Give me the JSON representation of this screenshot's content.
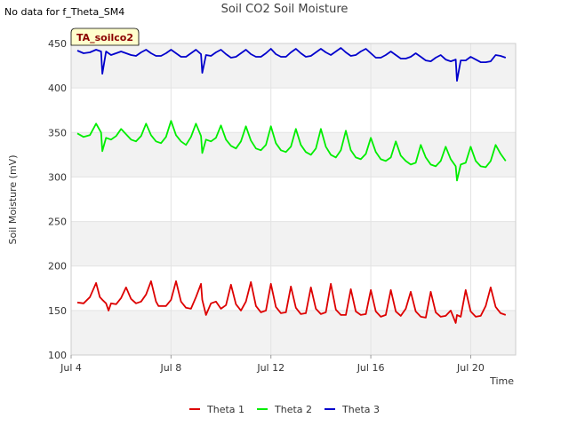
{
  "header": {
    "no_data_text": "No data for f_Theta_SM4",
    "title": "Soil CO2 Soil Moisture"
  },
  "chart_data": {
    "type": "line",
    "title": "Soil CO2 Soil Moisture",
    "xlabel": "Time",
    "ylabel": "Soil Moisture (mV)",
    "xlim": [
      4.0,
      21.8
    ],
    "ylim": [
      100,
      450
    ],
    "x_ticks": [
      4,
      8,
      12,
      16,
      20
    ],
    "x_tick_labels": [
      "Jul 4",
      "Jul 8",
      "Jul 12",
      "Jul 16",
      "Jul 20"
    ],
    "y_ticks": [
      100,
      150,
      200,
      250,
      300,
      350,
      400,
      450
    ],
    "y_tick_labels": [
      "100",
      "150",
      "200",
      "250",
      "300",
      "350",
      "400",
      "450"
    ],
    "grid": true,
    "banded_background": true,
    "legend_position": "bottom-center",
    "annotation_box": {
      "text": "TA_soilco2",
      "text_color": "#8B0000",
      "background": "#FFFFCC"
    },
    "x_units": "day of July",
    "series": [
      {
        "name": "Theta 1",
        "color": "#DD0000",
        "x": [
          4.25,
          4.5,
          4.75,
          5.0,
          5.15,
          5.25,
          5.4,
          5.5,
          5.6,
          5.8,
          6.0,
          6.2,
          6.4,
          6.6,
          6.8,
          7.0,
          7.2,
          7.4,
          7.5,
          7.8,
          8.0,
          8.2,
          8.4,
          8.6,
          8.8,
          9.0,
          9.2,
          9.25,
          9.4,
          9.6,
          9.8,
          10.0,
          10.2,
          10.4,
          10.6,
          10.8,
          11.0,
          11.2,
          11.4,
          11.6,
          11.8,
          12.0,
          12.2,
          12.4,
          12.6,
          12.8,
          13.0,
          13.2,
          13.4,
          13.6,
          13.8,
          14.0,
          14.2,
          14.4,
          14.6,
          14.8,
          15.0,
          15.2,
          15.4,
          15.6,
          15.8,
          16.0,
          16.2,
          16.4,
          16.6,
          16.8,
          17.0,
          17.2,
          17.4,
          17.6,
          17.8,
          18.0,
          18.2,
          18.4,
          18.6,
          18.8,
          19.0,
          19.2,
          19.4,
          19.45,
          19.6,
          19.8,
          20.0,
          20.2,
          20.4,
          20.6,
          20.8,
          21.0,
          21.2,
          21.4
        ],
        "y": [
          159,
          158,
          165,
          181,
          165,
          162,
          158,
          150,
          158,
          157,
          164,
          176,
          163,
          158,
          160,
          168,
          183,
          160,
          155,
          155,
          162,
          183,
          160,
          153,
          152,
          165,
          180,
          162,
          145,
          158,
          160,
          152,
          156,
          179,
          157,
          150,
          160,
          182,
          155,
          148,
          150,
          180,
          154,
          147,
          148,
          177,
          153,
          146,
          147,
          176,
          152,
          146,
          148,
          180,
          151,
          145,
          145,
          174,
          149,
          145,
          146,
          173,
          149,
          143,
          145,
          173,
          149,
          144,
          152,
          171,
          149,
          143,
          142,
          171,
          148,
          143,
          144,
          150,
          136,
          145,
          143,
          173,
          149,
          143,
          144,
          155,
          176,
          154,
          147,
          145
        ]
      },
      {
        "name": "Theta 2",
        "color": "#00EE00",
        "x": [
          4.25,
          4.5,
          4.75,
          5.0,
          5.2,
          5.25,
          5.4,
          5.6,
          5.8,
          6.0,
          6.2,
          6.4,
          6.6,
          6.8,
          7.0,
          7.2,
          7.4,
          7.6,
          7.8,
          8.0,
          8.2,
          8.4,
          8.6,
          8.8,
          9.0,
          9.2,
          9.25,
          9.4,
          9.6,
          9.8,
          10.0,
          10.2,
          10.4,
          10.6,
          10.8,
          11.0,
          11.2,
          11.4,
          11.6,
          11.8,
          12.0,
          12.2,
          12.4,
          12.6,
          12.8,
          13.0,
          13.2,
          13.4,
          13.6,
          13.8,
          14.0,
          14.2,
          14.4,
          14.6,
          14.8,
          15.0,
          15.2,
          15.4,
          15.6,
          15.8,
          16.0,
          16.2,
          16.4,
          16.6,
          16.8,
          17.0,
          17.2,
          17.4,
          17.6,
          17.8,
          18.0,
          18.2,
          18.4,
          18.6,
          18.8,
          19.0,
          19.2,
          19.4,
          19.45,
          19.6,
          19.8,
          20.0,
          20.2,
          20.4,
          20.6,
          20.8,
          21.0,
          21.2,
          21.4
        ],
        "y": [
          349,
          345,
          347,
          360,
          350,
          329,
          344,
          342,
          346,
          354,
          348,
          342,
          340,
          346,
          360,
          347,
          340,
          338,
          345,
          363,
          347,
          340,
          336,
          345,
          360,
          346,
          327,
          342,
          340,
          344,
          358,
          342,
          335,
          332,
          340,
          357,
          341,
          332,
          330,
          336,
          357,
          338,
          330,
          328,
          334,
          354,
          336,
          328,
          325,
          332,
          354,
          334,
          325,
          322,
          330,
          352,
          330,
          322,
          320,
          326,
          344,
          328,
          320,
          318,
          322,
          340,
          324,
          318,
          314,
          316,
          336,
          322,
          314,
          312,
          318,
          334,
          320,
          312,
          296,
          314,
          316,
          334,
          318,
          312,
          311,
          318,
          336,
          326,
          318
        ]
      },
      {
        "name": "Theta 3",
        "color": "#0000CC",
        "x": [
          4.25,
          4.5,
          4.75,
          5.0,
          5.2,
          5.25,
          5.4,
          5.6,
          5.8,
          6.0,
          6.2,
          6.4,
          6.6,
          6.8,
          7.0,
          7.2,
          7.4,
          7.6,
          7.8,
          8.0,
          8.2,
          8.4,
          8.6,
          8.8,
          9.0,
          9.2,
          9.25,
          9.4,
          9.6,
          9.8,
          10.0,
          10.2,
          10.4,
          10.6,
          10.8,
          11.0,
          11.2,
          11.4,
          11.6,
          11.8,
          12.0,
          12.2,
          12.4,
          12.6,
          12.8,
          13.0,
          13.2,
          13.4,
          13.6,
          13.8,
          14.0,
          14.2,
          14.4,
          14.6,
          14.8,
          15.0,
          15.2,
          15.4,
          15.6,
          15.8,
          16.0,
          16.2,
          16.4,
          16.6,
          16.8,
          17.0,
          17.2,
          17.4,
          17.6,
          17.8,
          18.0,
          18.2,
          18.4,
          18.6,
          18.8,
          19.0,
          19.2,
          19.4,
          19.45,
          19.6,
          19.8,
          20.0,
          20.2,
          20.4,
          20.6,
          20.8,
          21.0,
          21.2,
          21.4
        ],
        "y": [
          442,
          439,
          440,
          443,
          441,
          416,
          441,
          437,
          439,
          441,
          439,
          437,
          436,
          440,
          443,
          439,
          436,
          436,
          439,
          443,
          439,
          435,
          435,
          439,
          443,
          438,
          417,
          437,
          436,
          440,
          443,
          438,
          434,
          435,
          439,
          443,
          438,
          435,
          435,
          439,
          444,
          438,
          435,
          435,
          440,
          444,
          439,
          435,
          436,
          440,
          444,
          440,
          437,
          441,
          445,
          440,
          436,
          437,
          441,
          444,
          439,
          434,
          434,
          437,
          441,
          437,
          433,
          433,
          435,
          439,
          435,
          431,
          430,
          434,
          437,
          432,
          430,
          432,
          408,
          431,
          431,
          435,
          432,
          429,
          429,
          430,
          437,
          436,
          434
        ]
      }
    ]
  }
}
